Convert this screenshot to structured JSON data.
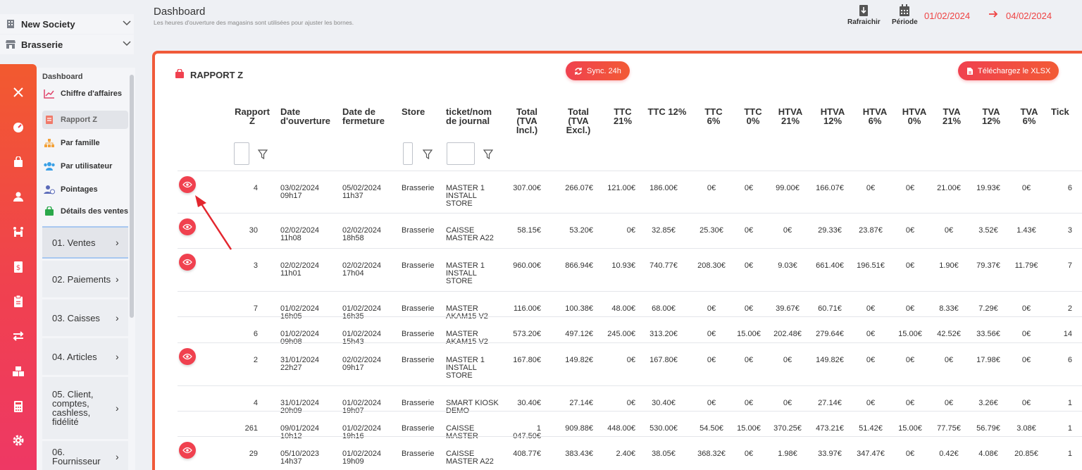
{
  "selectors": {
    "company": "New Society",
    "store": "Brasserie"
  },
  "menu": {
    "heading": "Dashboard",
    "items": [
      {
        "label": "Chiffre d'affaires"
      },
      {
        "label": "Rapport Z"
      },
      {
        "label": "Par famille"
      },
      {
        "label": "Par utilisateur"
      },
      {
        "label": "Pointages"
      },
      {
        "label": "Détails des ventes"
      }
    ],
    "sections": [
      {
        "label": "01. Ventes"
      },
      {
        "label": "02. Paiements"
      },
      {
        "label": "03. Caisses"
      },
      {
        "label": "04. Articles"
      },
      {
        "label": "05. Client, comptes, cashless, fidélité"
      },
      {
        "label": "06. Fournisseur"
      }
    ]
  },
  "header": {
    "title": "Dashboard",
    "subtitle": "Les heures d'ouverture des magasins sont utilisées pour ajuster les bornes.",
    "refresh_label": "Rafraichir",
    "period_label": "Période",
    "date_from": "01/02/2024",
    "date_to": "04/02/2024"
  },
  "card": {
    "title": "RAPPORT Z",
    "sync_label": "Sync. 24h",
    "download_label": "Téléchargez le XLSX"
  },
  "table": {
    "columns": [
      "Rapport Z",
      "Date d'ouverture",
      "Date de fermeture",
      "Store",
      "ticket/nom de journal",
      "Total (TVA Incl.)",
      "Total (TVA Excl.)",
      "TTC 21%",
      "TTC 12%",
      "TTC 6%",
      "TTC 0%",
      "HTVA 21%",
      "HTVA 12%",
      "HTVA 6%",
      "HTVA 0%",
      "TVA 21%",
      "TVA 12%",
      "TVA 6%",
      "Tick"
    ],
    "rows": [
      {
        "eye": true,
        "z": "4",
        "open": "03/02/2024 09h17",
        "close": "05/02/2024 11h37",
        "store": "Brasserie",
        "journal": "MASTER 1 INSTALL STORE",
        "vals": [
          "307.00€",
          "266.07€",
          "121.00€",
          "186.00€",
          "0€",
          "0€",
          "99.00€",
          "166.07€",
          "0€",
          "0€",
          "21.00€",
          "19.93€",
          "0€",
          "6"
        ]
      },
      {
        "eye": true,
        "z": "30",
        "open": "02/02/2024 11h08",
        "close": "02/02/2024 18h58",
        "store": "Brasserie",
        "journal": "CAISSE MASTER A22",
        "vals": [
          "58.15€",
          "53.20€",
          "0€",
          "32.85€",
          "25.30€",
          "0€",
          "0€",
          "29.33€",
          "23.87€",
          "0€",
          "0€",
          "3.52€",
          "1.43€",
          "3"
        ]
      },
      {
        "eye": true,
        "z": "3",
        "open": "02/02/2024 11h01",
        "close": "02/02/2024 17h04",
        "store": "Brasserie",
        "journal": "MASTER 1 INSTALL STORE",
        "vals": [
          "960.00€",
          "866.94€",
          "10.93€",
          "740.77€",
          "208.30€",
          "0€",
          "9.03€",
          "661.40€",
          "196.51€",
          "0€",
          "1.90€",
          "79.37€",
          "11.79€",
          "7"
        ]
      },
      {
        "eye": false,
        "z": "7",
        "open": "01/02/2024 16h05",
        "close": "01/02/2024 16h35",
        "store": "Brasserie",
        "journal": "MASTER AKAM15 V2",
        "vals": [
          "116.00€",
          "100.38€",
          "48.00€",
          "68.00€",
          "0€",
          "0€",
          "39.67€",
          "60.71€",
          "0€",
          "0€",
          "8.33€",
          "7.29€",
          "0€",
          "2"
        ]
      },
      {
        "eye": false,
        "z": "6",
        "open": "01/02/2024 09h08",
        "close": "01/02/2024 15h43",
        "store": "Brasserie",
        "journal": "MASTER AKAM15 V2",
        "vals": [
          "573.20€",
          "497.12€",
          "245.00€",
          "313.20€",
          "0€",
          "15.00€",
          "202.48€",
          "279.64€",
          "0€",
          "15.00€",
          "42.52€",
          "33.56€",
          "0€",
          "14"
        ]
      },
      {
        "eye": true,
        "z": "2",
        "open": "31/01/2024 22h27",
        "close": "02/02/2024 09h17",
        "store": "Brasserie",
        "journal": "MASTER 1 INSTALL STORE",
        "vals": [
          "167.80€",
          "149.82€",
          "0€",
          "167.80€",
          "0€",
          "0€",
          "0€",
          "149.82€",
          "0€",
          "0€",
          "0€",
          "17.98€",
          "0€",
          "6"
        ]
      },
      {
        "eye": false,
        "z": "4",
        "open": "31/01/2024 20h09",
        "close": "01/02/2024 19h07",
        "store": "Brasserie",
        "journal": "SMART KIOSK DEMO",
        "vals": [
          "30.40€",
          "27.14€",
          "0€",
          "30.40€",
          "0€",
          "0€",
          "0€",
          "27.14€",
          "0€",
          "0€",
          "0€",
          "3.26€",
          "0€",
          "1"
        ]
      },
      {
        "eye": false,
        "z": "261",
        "open": "09/01/2024 10h12",
        "close": "01/02/2024 19h16",
        "store": "Brasserie",
        "journal": "CAISSE MASTER",
        "vals": [
          "1 047.50€",
          "909.88€",
          "448.00€",
          "530.00€",
          "54.50€",
          "15.00€",
          "370.25€",
          "473.21€",
          "51.42€",
          "15.00€",
          "77.75€",
          "56.79€",
          "3.08€",
          "1"
        ]
      },
      {
        "eye": true,
        "z": "29",
        "open": "05/10/2023 14h37",
        "close": "01/02/2024 19h09",
        "store": "Brasserie",
        "journal": "CAISSE MASTER A22",
        "vals": [
          "408.77€",
          "383.43€",
          "2.40€",
          "38.05€",
          "368.32€",
          "0€",
          "1.98€",
          "33.97€",
          "347.47€",
          "0€",
          "0.42€",
          "4.08€",
          "20.85€",
          "1"
        ]
      }
    ]
  },
  "colors": {
    "accent": "#f0414f",
    "accent_orange": "#f25a35",
    "date": "#ef4343"
  }
}
